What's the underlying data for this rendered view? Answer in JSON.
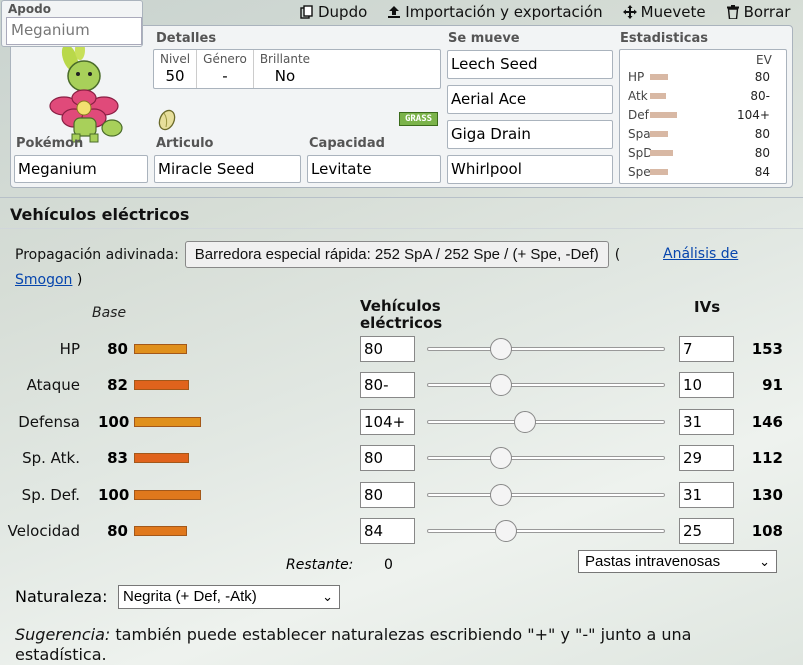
{
  "toolbar": {
    "duplicate": "Dupdo",
    "import_export": "Importación y exportación",
    "move": "Muevete",
    "delete": "Borrar"
  },
  "nickname": {
    "label": "Apodo",
    "placeholder": "Meganium"
  },
  "details": {
    "label": "Detalles",
    "level_label": "Nivel",
    "level": "50",
    "gender_label": "Género",
    "gender": "-",
    "shiny_label": "Brillante",
    "shiny": "No"
  },
  "type_badge": "GRASS",
  "pokemon": {
    "label": "Pokémon",
    "value": "Meganium"
  },
  "item": {
    "label": "Articulo",
    "value": "Miracle Seed"
  },
  "ability": {
    "label": "Capacidad",
    "value": "Levitate"
  },
  "moves": {
    "label": "Se mueve",
    "list": [
      "Leech Seed",
      "Aerial Ace",
      "Giga Drain",
      "Whirlpool"
    ]
  },
  "mini_stats": {
    "label": "Estadisticas",
    "ev_header": "EV",
    "rows": [
      {
        "name": "HP",
        "ev": "80",
        "bar": 0.18
      },
      {
        "name": "Atk",
        "ev": "80-",
        "bar": 0.16
      },
      {
        "name": "Def",
        "ev": "104+",
        "bar": 0.27
      },
      {
        "name": "Spa",
        "ev": "80",
        "bar": 0.18
      },
      {
        "name": "SpD",
        "ev": "80",
        "bar": 0.23
      },
      {
        "name": "Spe",
        "ev": "84",
        "bar": 0.18
      }
    ]
  },
  "section_title": "Vehículos eléctricos",
  "spread": {
    "label": "Propagación adivinada:",
    "button": "Barredora especial rápida: 252 SpA / 252 Spe / (+ Spe, -Def)",
    "open_paren": "(",
    "link": "Análisis de Smogon",
    "close_paren": ")"
  },
  "headers": {
    "base": "Base",
    "ev": "Vehículos eléctricos",
    "iv": "IVs"
  },
  "stats": [
    {
      "name": "HP",
      "base": "80",
      "ev": "80",
      "iv": "7",
      "total": "153",
      "bar_color": "#e0901c",
      "ev_fraction": 0.31
    },
    {
      "name": "Ataque",
      "base": "82",
      "ev": "80-",
      "iv": "10",
      "total": "91",
      "bar_color": "#e0631c",
      "ev_fraction": 0.31
    },
    {
      "name": "Defensa",
      "base": "100",
      "ev": "104+",
      "iv": "31",
      "total": "146",
      "bar_color": "#e0901c",
      "ev_fraction": 0.41
    },
    {
      "name": "Sp. Atk.",
      "base": "83",
      "ev": "80",
      "iv": "29",
      "total": "112",
      "bar_color": "#e0631c",
      "ev_fraction": 0.31
    },
    {
      "name": "Sp. Def.",
      "base": "100",
      "ev": "80",
      "iv": "31",
      "total": "130",
      "bar_color": "#e0781c",
      "ev_fraction": 0.31
    },
    {
      "name": "Velocidad",
      "base": "80",
      "ev": "84",
      "iv": "25",
      "total": "108",
      "bar_color": "#e0781c",
      "ev_fraction": 0.33
    }
  ],
  "remaining": {
    "label": "Restante:",
    "value": "0"
  },
  "item_select": "Pastas intravenosas",
  "nature": {
    "label": "Naturaleza:",
    "value": "Negrita (+ Def, -Atk)"
  },
  "tip": {
    "prefix": "Sugerencia:",
    "text": " también puede establecer naturalezas escribiendo \"+\" y \"-\" junto a una estadística."
  }
}
